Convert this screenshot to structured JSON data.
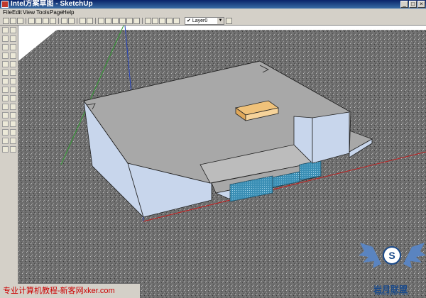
{
  "window": {
    "title": "Intel方案草图 - SketchUp"
  },
  "menu": [
    {
      "label": "File"
    },
    {
      "label": "Edit"
    },
    {
      "label": "View"
    },
    {
      "label": "Tools"
    },
    {
      "label": "Page"
    },
    {
      "label": "Help"
    }
  ],
  "toolbar": {
    "layer": "Layer0",
    "layer_check": "✔"
  },
  "titlebar_buttons": {
    "minimize": "_",
    "maximize": "□",
    "close": "×"
  },
  "watermark": {
    "text": "专业计算机教程-新客网xker.com"
  },
  "logo": {
    "text": "岩月联盟",
    "url": "www.5yue.com",
    "badge": "S"
  },
  "colors": {
    "ground": "#6e6e6e",
    "roof": "#a8a8a8",
    "wall": "#c8d6ec",
    "glass": "#3b8fb5",
    "box": "#f0c27a",
    "accent": "#0a246a"
  }
}
